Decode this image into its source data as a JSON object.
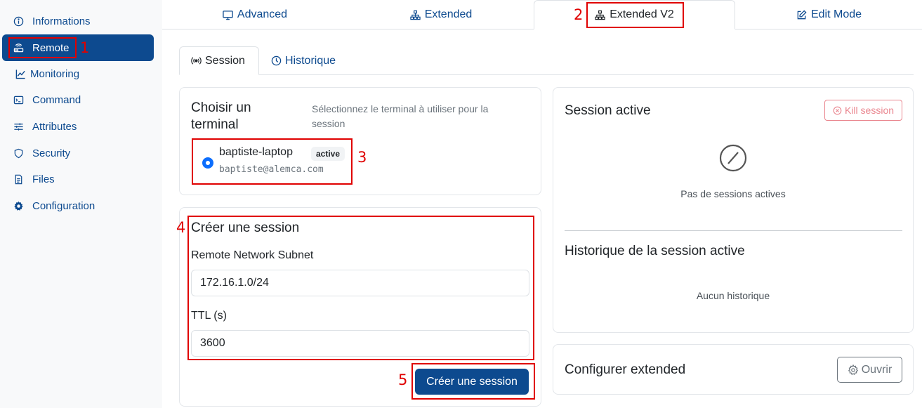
{
  "sidebar": {
    "items": [
      {
        "label": "Informations",
        "icon": "info-circle-icon"
      },
      {
        "label": "Remote",
        "icon": "router-icon",
        "active": true
      },
      {
        "label": "Monitoring",
        "icon": "chart-line-icon"
      },
      {
        "label": "Command",
        "icon": "terminal-icon"
      },
      {
        "label": "Attributes",
        "icon": "sliders-icon"
      },
      {
        "label": "Security",
        "icon": "shield-icon"
      },
      {
        "label": "Files",
        "icon": "file-icon"
      },
      {
        "label": "Configuration",
        "icon": "gear-icon"
      }
    ]
  },
  "top_tabs": [
    {
      "label": "Advanced",
      "icon": "monitor-icon"
    },
    {
      "label": "Extended",
      "icon": "network-icon"
    },
    {
      "label": "Extended V2",
      "icon": "network-icon",
      "active": true
    },
    {
      "label": "Edit Mode",
      "icon": "edit-icon"
    }
  ],
  "sub_tabs": [
    {
      "label": "Session",
      "icon": "broadcast-icon",
      "active": true
    },
    {
      "label": "Historique",
      "icon": "clock-icon"
    }
  ],
  "terminal_card": {
    "title": "Choisir un terminal",
    "title_line1": "Choisir un",
    "title_line2": "terminal",
    "description": "Sélectionnez le terminal à utiliser pour la session",
    "terminal": {
      "name": "baptiste-laptop",
      "badge": "active",
      "email": "baptiste@alemca.com",
      "selected": true
    }
  },
  "create_card": {
    "title": "Créer une session",
    "subnet_label": "Remote Network Subnet",
    "subnet_value": "172.16.1.0/24",
    "ttl_label": "TTL (s)",
    "ttl_value": "3600",
    "submit_label": "Créer une session"
  },
  "session_card": {
    "title": "Session active",
    "kill_label": "Kill session",
    "empty_text": "Pas de sessions actives",
    "history_title": "Historique de la session active",
    "history_empty": "Aucun historique"
  },
  "config_card": {
    "title": "Configurer extended",
    "open_label": "Ouvrir"
  },
  "annotations": [
    "1",
    "2",
    "3",
    "4",
    "5"
  ],
  "colors": {
    "primary": "#0d4a8f",
    "annotation": "#e00000",
    "danger": "#dc3545"
  }
}
